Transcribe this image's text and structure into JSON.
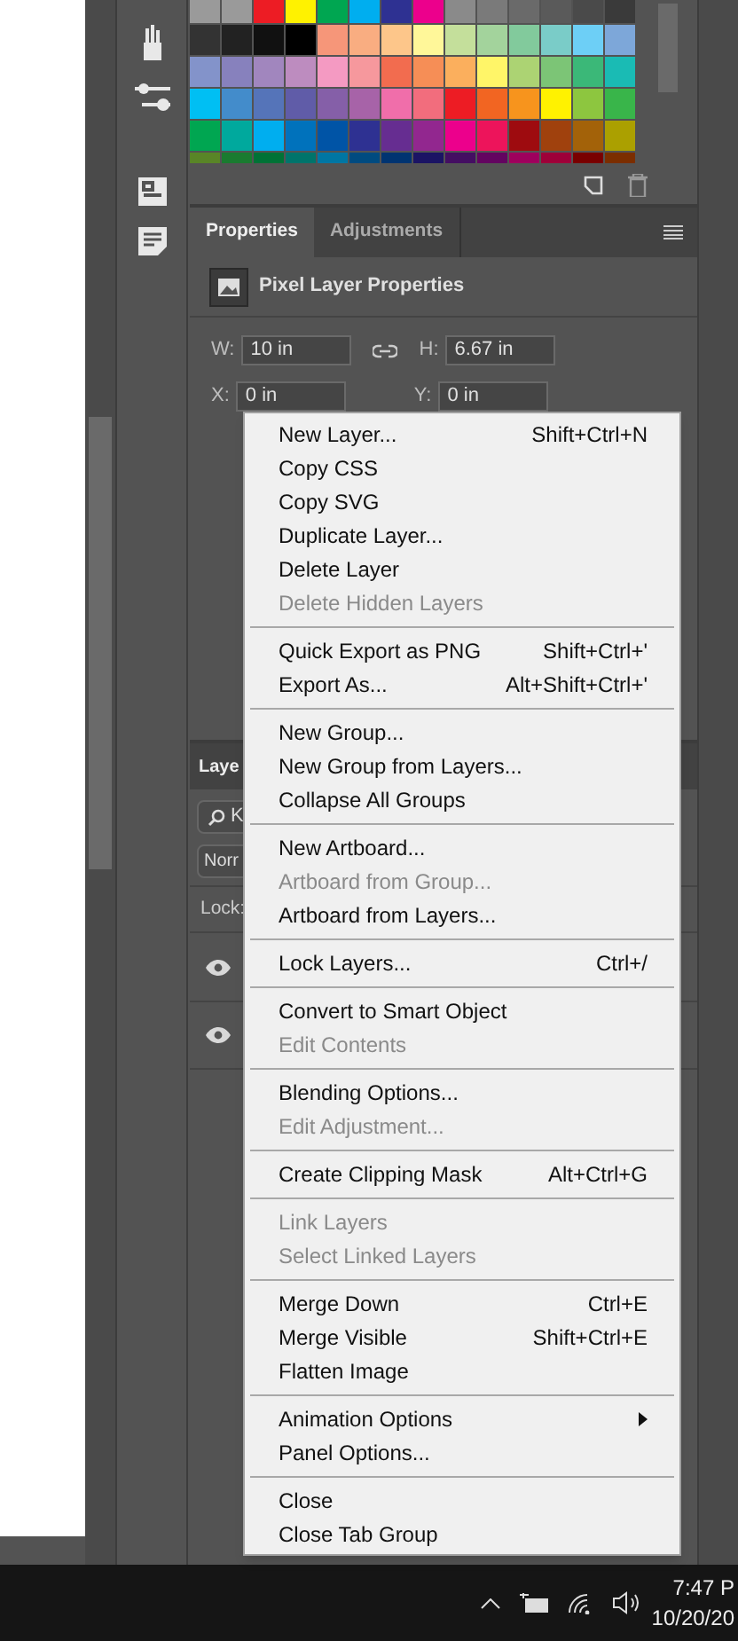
{
  "properties_panel": {
    "tabs": [
      {
        "label": "Properties",
        "selected": true
      },
      {
        "label": "Adjustments",
        "selected": false
      }
    ],
    "title": "Pixel Layer Properties",
    "fields": [
      {
        "label": "W:",
        "value": "10 in"
      },
      {
        "label": "H:",
        "value": "6.67 in"
      },
      {
        "label": "X:",
        "value": "0 in"
      },
      {
        "label": "Y:",
        "value": "0 in"
      }
    ]
  },
  "layers_panel": {
    "tab": "Laye",
    "search": "K",
    "blend_mode": "Norr",
    "lock": "Lock:"
  },
  "context_menu": [
    [
      {
        "label": "New Layer...",
        "shortcut": "Shift+Ctrl+N",
        "disabled": false,
        "submenu": false
      },
      {
        "label": "Copy CSS",
        "disabled": false,
        "submenu": false
      },
      {
        "label": "Copy SVG",
        "disabled": false,
        "submenu": false
      },
      {
        "label": "Duplicate Layer...",
        "disabled": false,
        "submenu": false
      },
      {
        "label": "Delete Layer",
        "disabled": false,
        "submenu": false
      },
      {
        "label": "Delete Hidden Layers",
        "disabled": true,
        "submenu": false
      }
    ],
    [
      {
        "label": "Quick Export as PNG",
        "shortcut": "Shift+Ctrl+'",
        "disabled": false,
        "submenu": false
      },
      {
        "label": "Export As...",
        "shortcut": "Alt+Shift+Ctrl+'",
        "disabled": false,
        "submenu": false
      }
    ],
    [
      {
        "label": "New Group...",
        "disabled": false,
        "submenu": false
      },
      {
        "label": "New Group from Layers...",
        "disabled": false,
        "submenu": false
      },
      {
        "label": "Collapse All Groups",
        "disabled": false,
        "submenu": false
      }
    ],
    [
      {
        "label": "New Artboard...",
        "disabled": false,
        "submenu": false
      },
      {
        "label": "Artboard from Group...",
        "disabled": true,
        "submenu": false
      },
      {
        "label": "Artboard from Layers...",
        "disabled": false,
        "submenu": false
      }
    ],
    [
      {
        "label": "Lock Layers...",
        "shortcut": "Ctrl+/",
        "disabled": false,
        "submenu": false
      }
    ],
    [
      {
        "label": "Convert to Smart Object",
        "disabled": false,
        "submenu": false
      },
      {
        "label": "Edit Contents",
        "disabled": true,
        "submenu": false
      }
    ],
    [
      {
        "label": "Blending Options...",
        "disabled": false,
        "submenu": false
      },
      {
        "label": "Edit Adjustment...",
        "disabled": true,
        "submenu": false
      }
    ],
    [
      {
        "label": "Create Clipping Mask",
        "shortcut": "Alt+Ctrl+G",
        "disabled": false,
        "submenu": false
      }
    ],
    [
      {
        "label": "Link Layers",
        "disabled": true,
        "submenu": false
      },
      {
        "label": "Select Linked Layers",
        "disabled": true,
        "submenu": false
      }
    ],
    [
      {
        "label": "Merge Down",
        "shortcut": "Ctrl+E",
        "disabled": false,
        "submenu": false
      },
      {
        "label": "Merge Visible",
        "shortcut": "Shift+Ctrl+E",
        "disabled": false,
        "submenu": false
      },
      {
        "label": "Flatten Image",
        "disabled": false,
        "submenu": false
      }
    ],
    [
      {
        "label": "Animation Options",
        "disabled": false,
        "submenu": true
      },
      {
        "label": "Panel Options...",
        "disabled": false,
        "submenu": false
      }
    ],
    [
      {
        "label": "Close",
        "disabled": false,
        "submenu": false
      },
      {
        "label": "Close Tab Group",
        "disabled": false,
        "submenu": false
      }
    ]
  ],
  "taskbar": {
    "time": "7:47 P",
    "date": "10/20/20"
  }
}
